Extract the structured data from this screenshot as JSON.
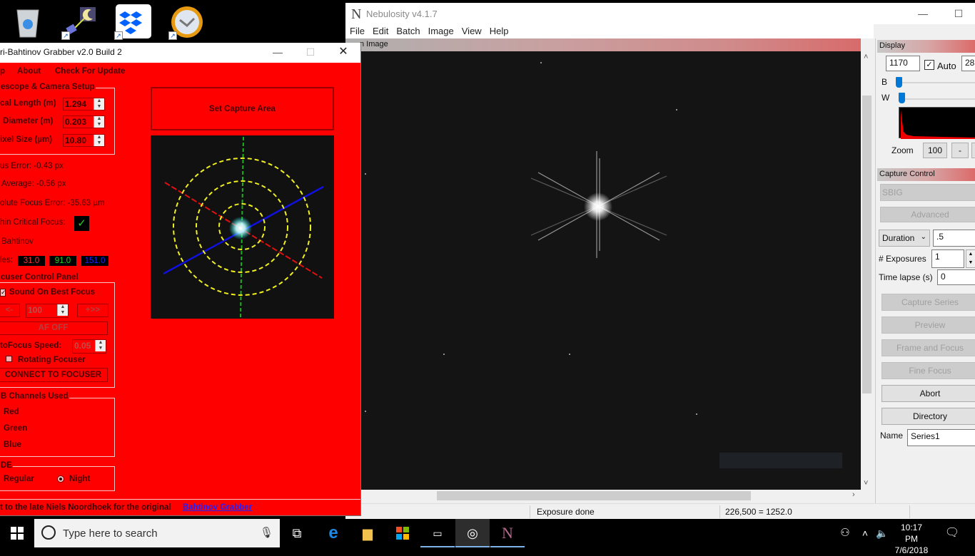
{
  "desktop": {
    "icons": [
      {
        "name": "recycle-bin"
      },
      {
        "name": "astronomy-shortcut"
      },
      {
        "name": "dropbox-shortcut"
      },
      {
        "name": "clock-shortcut"
      }
    ]
  },
  "nebulosity": {
    "title": "Nebulosity v4.1.7",
    "menu": [
      "File",
      "Edit",
      "Batch",
      "Image",
      "View",
      "Help"
    ],
    "image_pane_title": "n Image",
    "status": {
      "message": "Exposure done",
      "pixel_readout": "226,500 = 1252.0"
    },
    "display_panel": {
      "title": "Display",
      "black_value": "1170",
      "auto_label": "Auto",
      "auto_checked": true,
      "white_value": "28",
      "b_label": "B",
      "w_label": "W",
      "zoom_label": "Zoom",
      "zoom_value": "100",
      "zoom_minus": "-"
    },
    "capture_panel": {
      "title": "Capture Control",
      "camera": "SBIG",
      "advanced_label": "Advanced",
      "duration_select": "Duration",
      "duration_value": ".5",
      "exposures_label": "# Exposures",
      "exposures_value": "1",
      "timelapse_label": "Time lapse (s)",
      "timelapse_value": "0",
      "buttons": {
        "capture_series": "Capture Series",
        "preview": "Preview",
        "frame_focus": "Frame and Focus",
        "fine_focus": "Fine Focus",
        "abort": "Abort",
        "directory": "Directory"
      },
      "name_label": "Name",
      "name_value": "Series1"
    }
  },
  "grabber": {
    "title": "ri-Bahtinov Grabber v2.0 Build 2",
    "menu": [
      "p",
      "About",
      "Check For Update"
    ],
    "setup_group": "escope & Camera Setup",
    "focal_length_label": "cal Length (m)",
    "focal_length_value": "1.294",
    "diameter_label": "Diameter (m)",
    "diameter_value": "0.203",
    "pixel_size_label": "ixel Size (µm)",
    "pixel_size_value": "10.80",
    "focus_error": "us Error: -0.43 px",
    "average": "Average: -0.56 px",
    "absolute_error": "olute Focus Error: -35.63 µm",
    "critical_focus_label": "hin Critical Focus:",
    "critical_focus": true,
    "bahtinov_label": "Bahtinov",
    "angles_label": "les:",
    "angles": [
      "31.0",
      "91.0",
      "151.0"
    ],
    "angle_colors": [
      "#ff3030",
      "#22cc22",
      "#2222ff"
    ],
    "set_capture_area": "Set Capture Area",
    "focuser_group": "cuser Control Panel",
    "sound_label": "Sound On Best Focus",
    "sound_checked": true,
    "step_left": "<-",
    "step_value": "100",
    "step_right": "+>>",
    "af_button": "AF OFF",
    "af_speed_label": "toFocus Speed:",
    "af_speed_value": "0.05",
    "rotating_label": "Rotating Focuser",
    "rotating_checked": false,
    "connect_button": "CONNECT TO FOCUSER",
    "channels_group": "B Channels Used",
    "channels": [
      "Red",
      "Green",
      "Blue"
    ],
    "mode_group": "DE",
    "mode_options": [
      "Regular",
      "Night"
    ],
    "mode_selected": "Night",
    "credit_text": "t to the late Niels Noordhoek for the original",
    "credit_link": "Bahtinov Grabber"
  },
  "taskbar": {
    "search_placeholder": "Type here to search",
    "time": "10:17 PM",
    "date": "7/6/2018"
  }
}
